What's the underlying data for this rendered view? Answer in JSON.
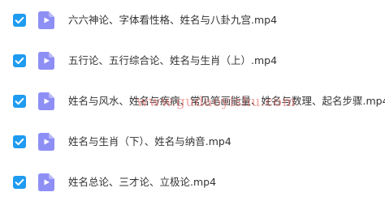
{
  "colors": {
    "checkbox": "#1f9bf0",
    "video_icon": "#8e8ff5",
    "text": "#333333",
    "watermark": "#e65a5a"
  },
  "files": [
    {
      "name": "六六神论、字体看性格、姓名与八卦九宫.mp4",
      "checked": true,
      "icon": "video-file-icon"
    },
    {
      "name": "五行论、五行综合论、姓名与生肖（上）.mp4",
      "checked": true,
      "icon": "video-file-icon"
    },
    {
      "name": "姓名与风水、姓名与疾病、常见笔画能量、姓名与数理、起名步骤.mp4",
      "checked": true,
      "icon": "video-file-icon"
    },
    {
      "name": "姓名与生肖（下）、姓名与纳音.mp4",
      "checked": true,
      "icon": "video-file-icon"
    },
    {
      "name": "姓名总论、三才论、立极论.mp4",
      "checked": true,
      "icon": "video-file-icon"
    }
  ],
  "watermark": "www.gudaoyishu.com"
}
